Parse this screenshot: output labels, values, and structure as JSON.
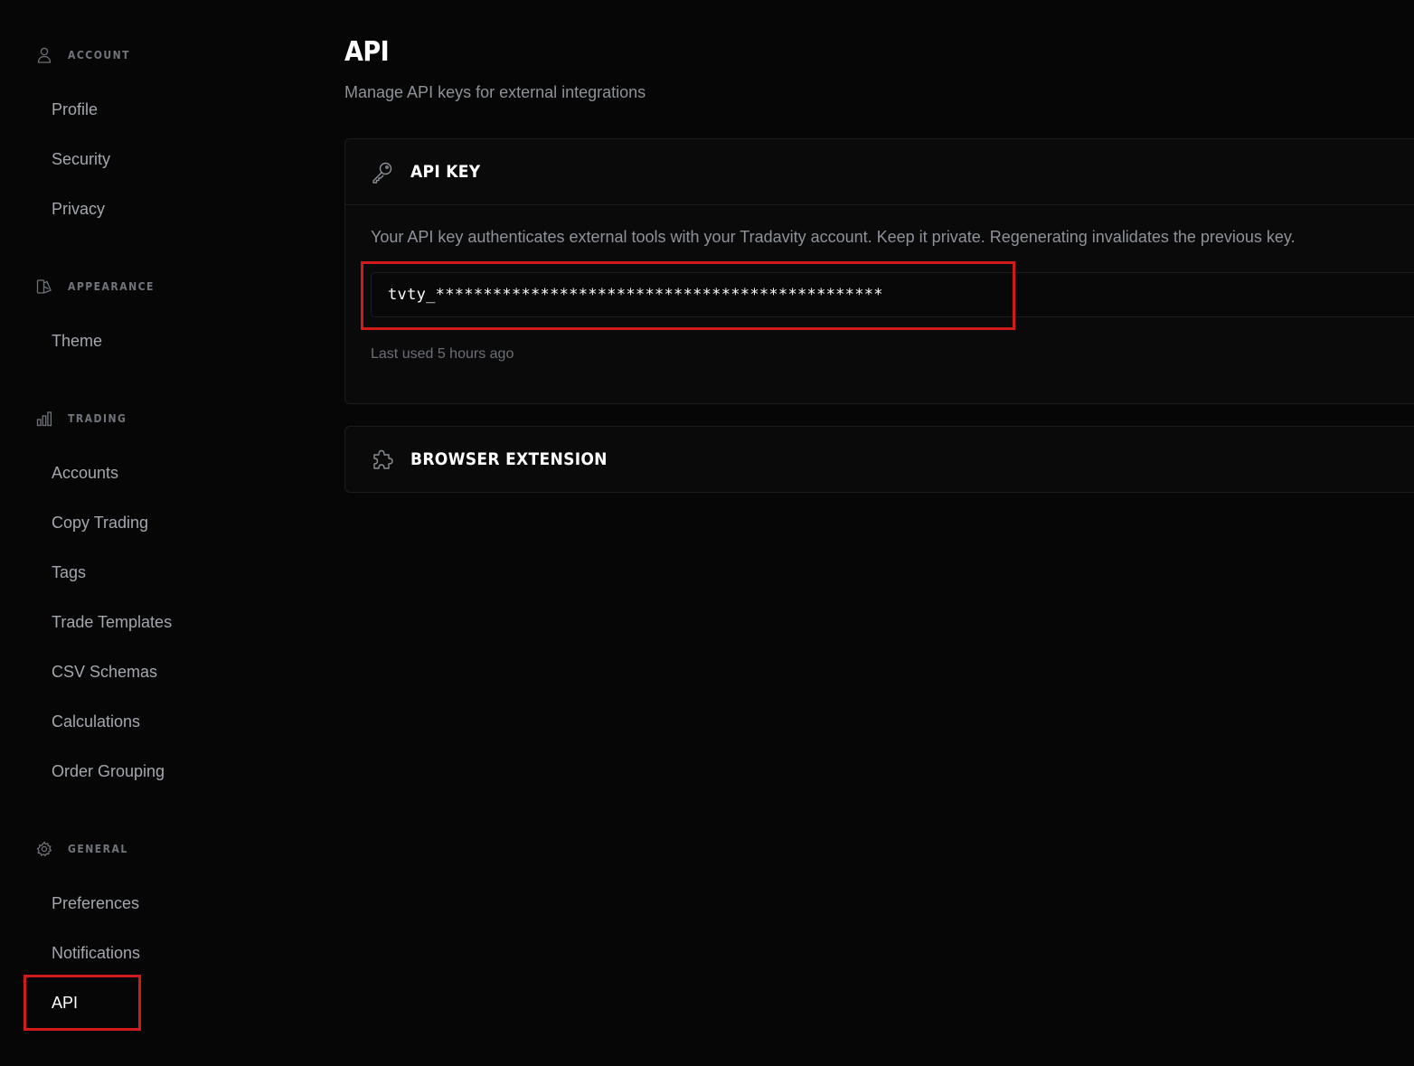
{
  "sidebar": {
    "sections": [
      {
        "title": "ACCOUNT",
        "icon": "user-icon",
        "items": [
          "Profile",
          "Security",
          "Privacy"
        ]
      },
      {
        "title": "APPEARANCE",
        "icon": "palette-icon",
        "items": [
          "Theme"
        ]
      },
      {
        "title": "TRADING",
        "icon": "bar-chart-icon",
        "items": [
          "Accounts",
          "Copy Trading",
          "Tags",
          "Trade Templates",
          "CSV Schemas",
          "Calculations",
          "Order Grouping"
        ]
      },
      {
        "title": "GENERAL",
        "icon": "gear-icon",
        "items": [
          "Preferences",
          "Notifications",
          "API"
        ]
      }
    ],
    "active_item": "API"
  },
  "main": {
    "title": "API",
    "subtitle": "Manage API keys for external integrations",
    "api_key_card": {
      "icon": "key-icon",
      "title": "API KEY",
      "description": "Your API key authenticates external tools with your Tradavity account. Keep it private. Regenerating invalidates the previous key.",
      "key_value": "tvty_***********************************************",
      "last_used": "Last used 5 hours ago"
    },
    "extension_card": {
      "icon": "puzzle-icon",
      "title": "BROWSER EXTENSION"
    }
  },
  "colors": {
    "background": "#060606",
    "card": "#0a0a0b",
    "highlight": "#d11a1a",
    "text_primary": "#ffffff",
    "text_muted": "#8e9299"
  }
}
